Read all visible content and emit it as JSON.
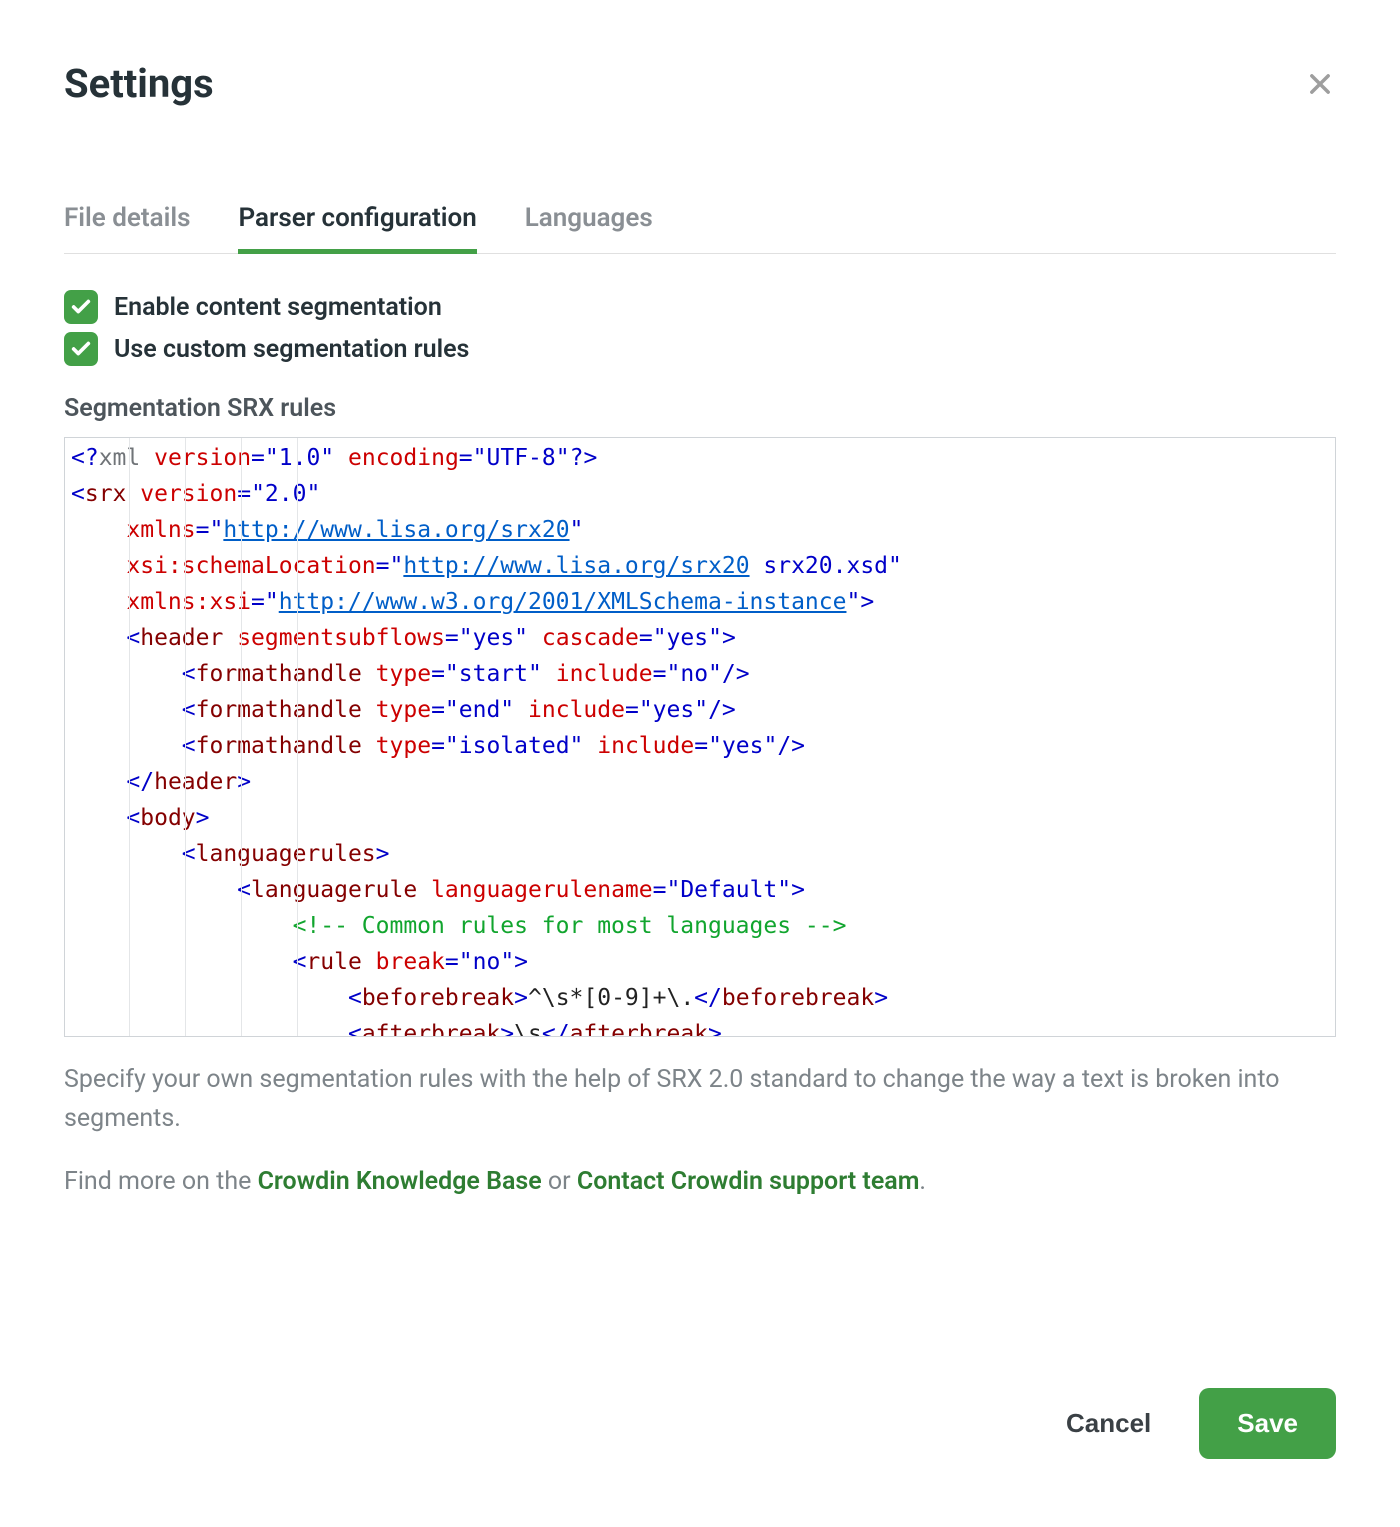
{
  "header": {
    "title": "Settings"
  },
  "tabs": {
    "file_details": "File details",
    "parser_config": "Parser configuration",
    "languages": "Languages"
  },
  "checks": {
    "enable_seg": "Enable content segmentation",
    "use_custom": "Use custom segmentation rules"
  },
  "section_label": "Segmentation SRX rules",
  "code": {
    "l1_decl_open": "<?",
    "l1_pi_xml": "xml",
    "l1_attr_version": "version",
    "l1_eq": "=",
    "l1_val_version": "\"1.0\"",
    "l1_attr_encoding": "encoding",
    "l1_val_encoding": "\"UTF-8\"",
    "l1_decl_close": "?>",
    "l2_lt": "<",
    "l2_tag_srx": "srx",
    "l2_attr_version": "version",
    "l2_val_version": "\"2.0\"",
    "l3_attr_xmlns": "xmlns",
    "l3_q": "\"",
    "l3_url_xmlns": "http://www.lisa.org/srx20",
    "l4_attr_schemaloc": "xsi:schemaLocation",
    "l4_url_schemaloc": "http://www.lisa.org/srx20",
    "l4_val_tail": " srx20.xsd\"",
    "l5_attr_xmlnsxsi": "xmlns:xsi",
    "l5_url_xmlnsxsi": "http://www.w3.org/2001/XMLSchema-instance",
    "l5_gt": ">",
    "l6_tag_header": "header",
    "l6_attr_ssf": "segmentsubflows",
    "l6_val_yes": "\"yes\"",
    "l6_attr_cascade": "cascade",
    "l7_tag_fh": "formathandle",
    "l7_attr_type": "type",
    "l7_val_start": "\"start\"",
    "l7_attr_include": "include",
    "l7_val_no": "\"no\"",
    "l8_val_end": "\"end\"",
    "l8_val_yes": "\"yes\"",
    "l9_val_isolated": "\"isolated\"",
    "l10_close_header": "</",
    "l11_tag_body": "body",
    "l12_tag_lrs": "languagerules",
    "l13_tag_lr": "languagerule",
    "l13_attr_lrn": "languagerulename",
    "l13_val_default": "\"Default\"",
    "l14_comment": "<!-- Common rules for most languages -->",
    "l15_tag_rule": "rule",
    "l15_attr_break": "break",
    "l15_val_no": "\"no\"",
    "l16_tag_bb": "beforebreak",
    "l16_text": "^\\s*[0-9]+\\.",
    "l17_tag_ab": "afterbreak",
    "l17_text": "\\s"
  },
  "help": {
    "p1": "Specify your own segmentation rules with the help of SRX 2.0 standard to change the way a text is broken into segments.",
    "p2_prefix": "Find more on the ",
    "p2_link1": "Crowdin Knowledge Base",
    "p2_mid": " or ",
    "p2_link2": "Contact Crowdin support team",
    "p2_suffix": "."
  },
  "footer": {
    "cancel": "Cancel",
    "save": "Save"
  }
}
